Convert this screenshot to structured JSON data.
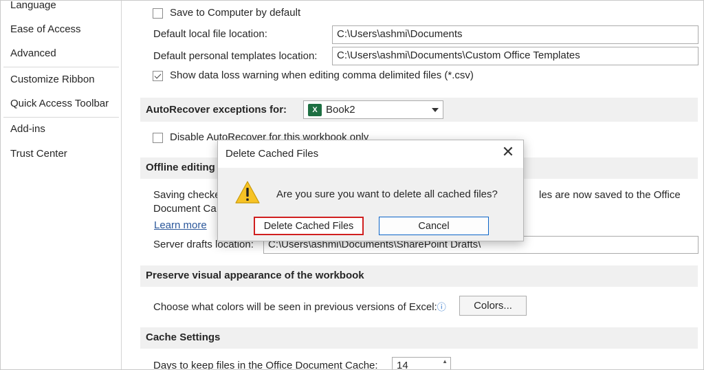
{
  "sidebar": {
    "items": [
      {
        "label": "Language"
      },
      {
        "label": "Ease of Access"
      },
      {
        "label": "Advanced"
      },
      {
        "label": "Customize Ribbon"
      },
      {
        "label": "Quick Access Toolbar"
      },
      {
        "label": "Add-ins"
      },
      {
        "label": "Trust Center"
      }
    ]
  },
  "save": {
    "save_to_computer_label": "Save to Computer by default",
    "default_local_label": "Default local file location:",
    "default_local_value": "C:\\Users\\ashmi\\Documents",
    "default_templates_label": "Default personal templates location:",
    "default_templates_value": "C:\\Users\\ashmi\\Documents\\Custom Office Templates",
    "csv_warning_label": "Show data loss warning when editing comma delimited files (*.csv)"
  },
  "autorecover": {
    "header": "AutoRecover exceptions for:",
    "workbook": "Book2",
    "workbook_icon": "X",
    "disable_label": "Disable AutoRecover for this workbook only"
  },
  "offline": {
    "header": "Offline editing",
    "text_line1_left": "Saving checke",
    "text_line1_right": "les are now saved to the Office",
    "text_line2": "Document Ca",
    "learn_more": "Learn more",
    "server_drafts_label": "Server drafts location:",
    "server_drafts_value": "C:\\Users\\ashmi\\Documents\\SharePoint Drafts\\"
  },
  "preserve": {
    "header": "Preserve visual appearance of the workbook",
    "colors_label": "Choose what colors will be seen in previous versions of Excel:",
    "info_icon": "ⓘ",
    "colors_button": "Colors..."
  },
  "cache": {
    "header": "Cache Settings",
    "days_label": "Days to keep files in the Office Document Cache:",
    "days_value": "14"
  },
  "dialog": {
    "title": "Delete Cached Files",
    "close_glyph": "✕",
    "message": "Are you sure you want to delete all cached files?",
    "confirm_label": "Delete Cached Files",
    "cancel_label": "Cancel"
  },
  "colors": {
    "highlight_border": "#d01f1f",
    "cancel_border": "#0a64c8",
    "excel_green": "#1d6f42",
    "warning_yellow": "#f7c325"
  }
}
